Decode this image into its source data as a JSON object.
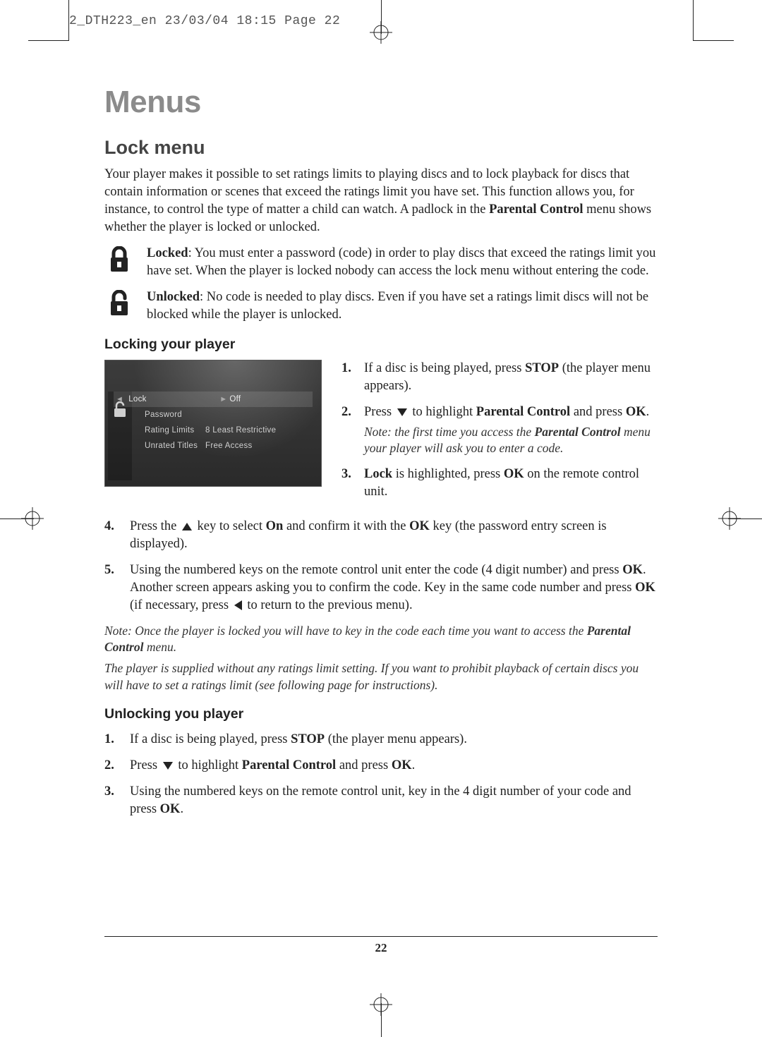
{
  "header_strip": "2_DTH223_en  23/03/04  18:15  Page 22",
  "page_number": "22",
  "title": "Menus",
  "section": "Lock menu",
  "intro_a": "Your player makes it possible to set ratings limits to playing discs and to lock playback for discs that contain information or scenes that exceed the ratings limit you have set. This function allows you, for instance, to control the type of matter a child can watch. A padlock in the ",
  "intro_b_bold": "Parental Control",
  "intro_c": " menu shows whether the player is locked or unlocked.",
  "locked_label": "Locked",
  "locked_text": ": You must enter a password (code) in order to play discs that exceed the ratings limit you have set. When the player is locked nobody can access the lock menu without entering the code.",
  "unlocked_label": "Unlocked",
  "unlocked_text": ": No code is needed to play discs. Even if you have set a ratings limit discs will not be blocked while the player is unlocked.",
  "sub1": "Locking your player",
  "shot": {
    "rows": [
      {
        "l": "Lock",
        "r": "Off"
      },
      {
        "l": "Password",
        "r": ""
      },
      {
        "l": "Rating Limits",
        "r": "8 Least Restrictive"
      },
      {
        "l": "Unrated Titles",
        "r": "Free Access"
      }
    ]
  },
  "r1_a": "If a disc is being played, press ",
  "r1_b": "STOP",
  "r1_c": " (the player menu appears).",
  "r2_a": "Press ",
  "r2_b": " to highlight ",
  "r2_c": "Parental Control",
  "r2_d": " and press ",
  "r2_e": "OK",
  "r2_f": ".",
  "r2_note_a": "Note: the first time you access the ",
  "r2_note_b": "Parental Control",
  "r2_note_c": " menu your player will ask you to enter a code.",
  "r3_a": "Lock",
  "r3_b": " is highlighted, press ",
  "r3_c": "OK",
  "r3_d": " on the remote control unit.",
  "s4_a": "Press the ",
  "s4_b": " key to select ",
  "s4_c": "On",
  "s4_d": " and confirm it with the ",
  "s4_e": "OK",
  "s4_f": " key (the password entry screen is displayed).",
  "s5_a": "Using the numbered keys on the remote control unit enter the code (4 digit number) and press ",
  "s5_b": "OK",
  "s5_c": ". Another screen appears asking you to confirm the code. Key in the same code number and press ",
  "s5_d": "OK",
  "s5_e": " (if necessary, press ",
  "s5_f": " to return to the previous menu).",
  "note2_a": "Note: Once the player is locked you will have to key in the code each time you want to access the ",
  "note2_b": "Parental Control",
  "note2_c": " menu.",
  "note3": "The player is supplied without any ratings limit setting. If you want to prohibit playback of certain discs you will have to set a ratings limit (see following page for instructions).",
  "sub2": "Unlocking you player",
  "u1_a": "If a disc is being played, press ",
  "u1_b": "STOP",
  "u1_c": " (the player menu appears).",
  "u2_a": "Press ",
  "u2_b": " to highlight ",
  "u2_c": "Parental Control",
  "u2_d": " and press ",
  "u2_e": "OK",
  "u2_f": ".",
  "u3_a": "Using the numbered keys on the remote control unit, key in the 4 digit number of your code and press ",
  "u3_b": "OK",
  "u3_c": "."
}
